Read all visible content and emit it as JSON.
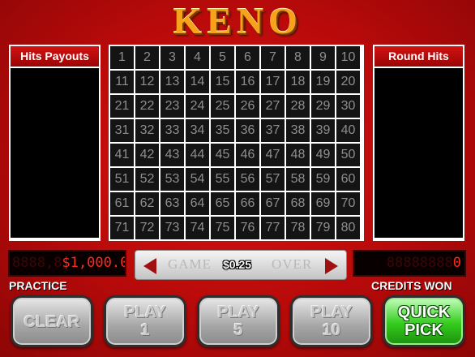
{
  "title": "KENO",
  "hits_payouts": {
    "header": "Hits Payouts"
  },
  "round_hits": {
    "header": "Round Hits"
  },
  "board": {
    "numbers": [
      "1",
      "2",
      "3",
      "4",
      "5",
      "6",
      "7",
      "8",
      "9",
      "10",
      "11",
      "12",
      "13",
      "14",
      "15",
      "16",
      "17",
      "18",
      "19",
      "20",
      "21",
      "22",
      "23",
      "24",
      "25",
      "26",
      "27",
      "28",
      "29",
      "30",
      "31",
      "32",
      "33",
      "34",
      "35",
      "36",
      "37",
      "38",
      "39",
      "40",
      "41",
      "42",
      "43",
      "44",
      "45",
      "46",
      "47",
      "48",
      "49",
      "50",
      "51",
      "52",
      "53",
      "54",
      "55",
      "56",
      "57",
      "58",
      "59",
      "60",
      "61",
      "62",
      "63",
      "64",
      "65",
      "66",
      "67",
      "68",
      "69",
      "70",
      "71",
      "72",
      "73",
      "74",
      "75",
      "76",
      "77",
      "78",
      "79",
      "80"
    ]
  },
  "credits_display": {
    "ghost": "8888,8",
    "value": "$1,000.00"
  },
  "credits_won_display": {
    "ghost": "88888888",
    "value": "0"
  },
  "game_bar": {
    "left_word": "GAME",
    "bet": "$0.25",
    "right_word": "OVER"
  },
  "labels": {
    "practice": "PRACTICE",
    "credits_won": "CREDITS WON"
  },
  "buttons": {
    "clear": "CLEAR",
    "play1": {
      "line1": "PLAY",
      "line2": "1"
    },
    "play5": {
      "line1": "PLAY",
      "line2": "5"
    },
    "play10": {
      "line1": "PLAY",
      "line2": "10"
    },
    "quick_pick": {
      "line1": "QUICK",
      "line2": "PICK"
    }
  },
  "colors": {
    "background": "#c40e0e",
    "title": "#f6a21a",
    "led": "#ff2a1a",
    "quick_pick": "#33cc1c"
  }
}
